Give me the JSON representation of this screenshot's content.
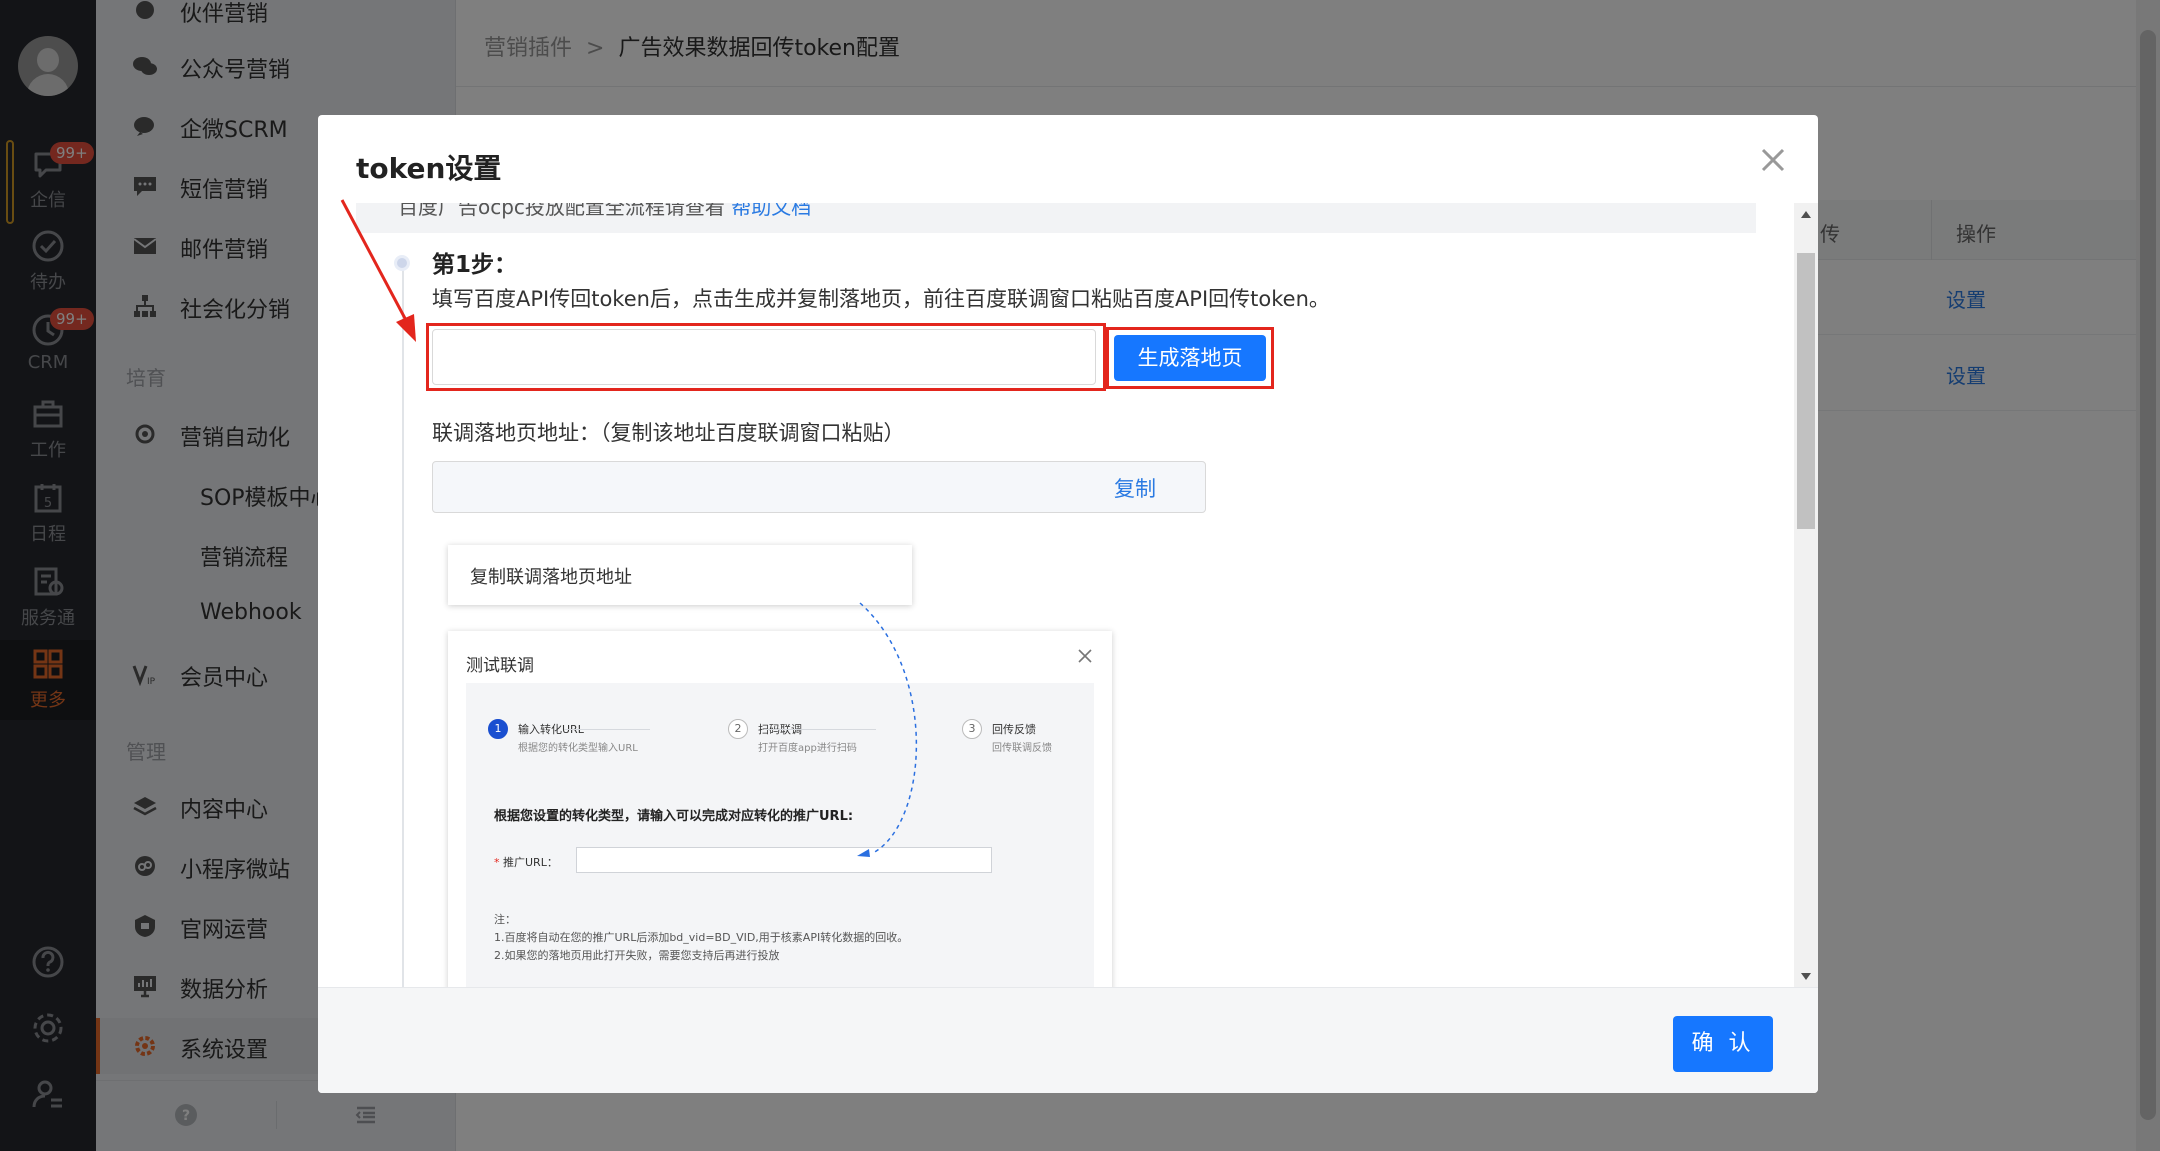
{
  "rail": {
    "items": [
      {
        "label": "企信",
        "badge": "99+",
        "icon": "chat-bubble-icon"
      },
      {
        "label": "待办",
        "icon": "check-circle-icon"
      },
      {
        "label": "CRM",
        "badge": "99+",
        "icon": "clock-icon"
      },
      {
        "label": "工作",
        "icon": "briefcase-icon"
      },
      {
        "label": "日程",
        "icon": "calendar-icon",
        "day": "5"
      },
      {
        "label": "服务通",
        "icon": "service-icon"
      },
      {
        "label": "更多",
        "icon": "grid-icon",
        "active": true
      }
    ],
    "bottom_icons": [
      "help-icon",
      "settings-icon",
      "user-settings-icon"
    ]
  },
  "menu": {
    "items": [
      {
        "label": "伙伴营销"
      },
      {
        "label": "公众号营销"
      },
      {
        "label": "企微SCRM"
      },
      {
        "label": "短信营销"
      },
      {
        "label": "邮件营销"
      },
      {
        "label": "社会化分销"
      }
    ],
    "group_culture": "培育",
    "culture_items": [
      {
        "label": "营销自动化"
      },
      {
        "label": "SOP模板中心"
      },
      {
        "label": "营销流程"
      },
      {
        "label": "Webhook"
      },
      {
        "label": "会员中心"
      }
    ],
    "group_manage": "管理",
    "manage_items": [
      {
        "label": "内容中心"
      },
      {
        "label": "小程序微站"
      },
      {
        "label": "官网运营"
      },
      {
        "label": "数据分析"
      },
      {
        "label": "系统设置"
      }
    ]
  },
  "breadcrumb": {
    "parent": "营销插件",
    "current": "广告效果数据回传token配置"
  },
  "table": {
    "col_partial": "传",
    "col_action": "操作",
    "row_actions": [
      "设置",
      "设置"
    ]
  },
  "modal": {
    "title": "token设置",
    "tip_text": "百度广告ocpc投放配置全流程请查看",
    "tip_link": "帮助文档",
    "step_title": "第1步：",
    "step_desc": "填写百度API传回token后，点击生成并复制落地页，前往百度联调窗口粘贴百度API回传token。",
    "token_value": "",
    "generate_button": "生成落地页",
    "landing_label": "联调落地页地址：（复制该地址百度联调窗口粘贴）",
    "landing_value": "",
    "copy_link": "复制",
    "confirm_button": "确 认",
    "illustration": {
      "copy_card": "复制联调落地页地址",
      "dialog_title": "测试联调",
      "steps": [
        {
          "num": "1",
          "title": "输入转化URL",
          "desc": "根据您的转化类型输入URL"
        },
        {
          "num": "2",
          "title": "扫码联调",
          "desc": "打开百度app进行扫码"
        },
        {
          "num": "3",
          "title": "回传反馈",
          "desc": "回传联调反馈"
        }
      ],
      "question": "根据您设置的转化类型，请输入可以完成对应转化的推广URL:",
      "url_label": "推广URL：",
      "note_title": "注：",
      "note_1": "1.百度将自动在您的推广URL后添加bd_vid=BD_VID,用于核素API转化数据的回收。",
      "note_2": "2.如果您的落地页用此打开失败，需要您支持后再进行投放"
    }
  },
  "colors": {
    "accent": "#1677ff",
    "highlight": "#e3261d",
    "rail_active": "#e96a2b"
  }
}
